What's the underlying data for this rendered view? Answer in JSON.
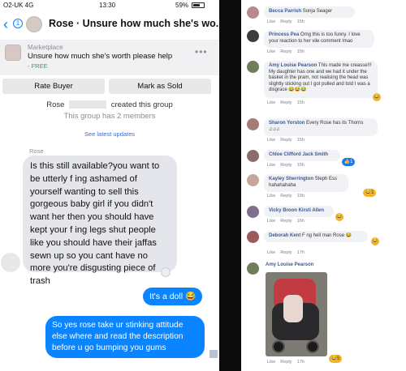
{
  "status": {
    "carrier": "O2-UK 4G",
    "time": "13:30",
    "battery": "59%"
  },
  "nav": {
    "back_glyph": "‹",
    "back_count": "1",
    "title": "Rose · Unsure how much she's wo..."
  },
  "listing": {
    "market": "Marketplace",
    "title": "Unsure how much she's worth please help",
    "price": "- FREE",
    "more": "•••"
  },
  "buttons": {
    "rate": "Rate Buyer",
    "sold": "Mark as Sold"
  },
  "group": {
    "creator": "Rose",
    "created": "created this group",
    "members": "This group has 2 members",
    "updates": "See latest updates"
  },
  "thread": {
    "sender": "Rose",
    "incoming": "Is this still available?you want to be utterly f ing ashamed of yourself wanting to sell this gorgeous baby girl if you didn't want her then you should have kept your f ing legs shut people like you should have their jaffas sewn up so you cant have no more you're disgusting piece of trash",
    "out1": "It's a doll 😂",
    "out2": "So yes rose take ur stinking attitude else where and read the description before u go bumping you gums"
  },
  "comments": [
    {
      "name": "Becca Parrish",
      "text": "Sonja Seager",
      "like": "Like",
      "reply": "Reply",
      "time": "15h",
      "avatar_color": "#b58b8b"
    },
    {
      "name": "Princess Pea",
      "text": "Omg this is too funny. I love your reaction to her vile comment lmao",
      "like": "Like",
      "reply": "Reply",
      "time": "15h",
      "avatar_color": "#3c3c3c"
    },
    {
      "name": "Amy Louise Pearson",
      "text": "This made me creasse!!! My daughter has one and we had it under the basket in the pram, not realising the head was slightly sticking out I got pulled and told I was a disgrace 😂😂😂",
      "like": "Like",
      "reply": "Reply",
      "time": "15h",
      "avatar_color": "#6f7d5a",
      "react": "😂"
    },
    {
      "name": "Sharon Yorston",
      "text": "Every Rose has its Thorns ♫♫♫",
      "like": "Like",
      "reply": "Reply",
      "time": "15h",
      "avatar_color": "#a37c76"
    },
    {
      "name": "Chloe Clifford",
      "text": "Jack Smith",
      "like": "Like",
      "reply": "Reply",
      "time": "15h",
      "avatar_color": "#8b6e6a",
      "react": "👍1"
    },
    {
      "name": "Kayley Sherrington",
      "text": "Steph Ess hahahahaha",
      "like": "Like",
      "reply": "Reply",
      "time": "15h",
      "avatar_color": "#c7a79a",
      "react": "😂1"
    },
    {
      "name": "Vicky Broon",
      "text": "Kirsti Allen",
      "like": "Like",
      "reply": "Reply",
      "time": "16h",
      "avatar_color": "#7f6f8e",
      "react": "😂"
    },
    {
      "name": "Deborah Kent",
      "text": "F ng hell man Rose 😂",
      "like": "Like",
      "reply": "Reply",
      "time": "17h",
      "avatar_color": "#9a5a5a",
      "react": "😂"
    },
    {
      "name": "Amy Louise Pearson",
      "text": "",
      "like": "Like",
      "reply": "Reply",
      "time": "17h",
      "avatar_color": "#6f7d5a",
      "react": "😂5"
    }
  ]
}
